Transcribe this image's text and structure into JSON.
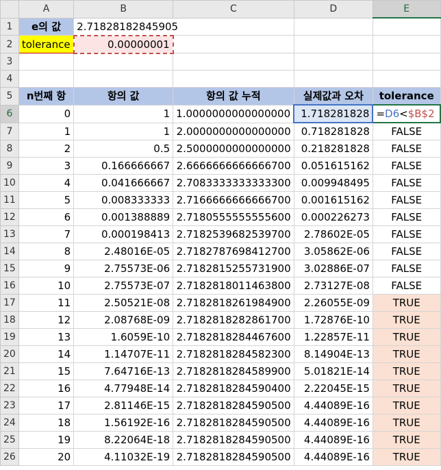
{
  "columns": [
    "A",
    "B",
    "C",
    "D",
    "E"
  ],
  "row_numbers": [
    "1",
    "2",
    "3",
    "4",
    "5",
    "6",
    "7",
    "8",
    "9",
    "10",
    "11",
    "12",
    "13",
    "14",
    "15",
    "16",
    "17",
    "18",
    "19",
    "20",
    "21",
    "22",
    "23",
    "24",
    "25",
    "26"
  ],
  "row1": {
    "label": "e의 값",
    "value": "2.71828182845905"
  },
  "row2": {
    "label": "tolerance",
    "value": "0.00000001"
  },
  "headers": {
    "a": "n번째 항",
    "b": "항의 값",
    "c": "항의 값 누적",
    "d": "실제값과 오차",
    "e": "tolerance"
  },
  "formula": {
    "eq": "=",
    "d": "D6",
    "lt": "<",
    "b": "$B$2"
  },
  "rows": [
    {
      "n": "0",
      "term": "1",
      "cum": "1.0000000000000000",
      "err": "1.718281828",
      "tol": ""
    },
    {
      "n": "1",
      "term": "1",
      "cum": "2.0000000000000000",
      "err": "0.718281828",
      "tol": "FALSE"
    },
    {
      "n": "2",
      "term": "0.5",
      "cum": "2.5000000000000000",
      "err": "0.218281828",
      "tol": "FALSE"
    },
    {
      "n": "3",
      "term": "0.166666667",
      "cum": "2.6666666666666700",
      "err": "0.051615162",
      "tol": "FALSE"
    },
    {
      "n": "4",
      "term": "0.041666667",
      "cum": "2.7083333333333300",
      "err": "0.009948495",
      "tol": "FALSE"
    },
    {
      "n": "5",
      "term": "0.008333333",
      "cum": "2.7166666666666700",
      "err": "0.001615162",
      "tol": "FALSE"
    },
    {
      "n": "6",
      "term": "0.001388889",
      "cum": "2.7180555555555600",
      "err": "0.000226273",
      "tol": "FALSE"
    },
    {
      "n": "7",
      "term": "0.000198413",
      "cum": "2.7182539682539700",
      "err": "2.78602E-05",
      "tol": "FALSE"
    },
    {
      "n": "8",
      "term": "2.48016E-05",
      "cum": "2.7182787698412700",
      "err": "3.05862E-06",
      "tol": "FALSE"
    },
    {
      "n": "9",
      "term": "2.75573E-06",
      "cum": "2.7182815255731900",
      "err": "3.02886E-07",
      "tol": "FALSE"
    },
    {
      "n": "10",
      "term": "2.75573E-07",
      "cum": "2.7182818011463800",
      "err": "2.73127E-08",
      "tol": "FALSE"
    },
    {
      "n": "11",
      "term": "2.50521E-08",
      "cum": "2.7182818261984900",
      "err": "2.26055E-09",
      "tol": "TRUE"
    },
    {
      "n": "12",
      "term": "2.08768E-09",
      "cum": "2.7182818282861700",
      "err": "1.72876E-10",
      "tol": "TRUE"
    },
    {
      "n": "13",
      "term": "1.6059E-10",
      "cum": "2.7182818284467600",
      "err": "1.22857E-11",
      "tol": "TRUE"
    },
    {
      "n": "14",
      "term": "1.14707E-11",
      "cum": "2.7182818284582300",
      "err": "8.14904E-13",
      "tol": "TRUE"
    },
    {
      "n": "15",
      "term": "7.64716E-13",
      "cum": "2.7182818284589900",
      "err": "5.01821E-14",
      "tol": "TRUE"
    },
    {
      "n": "16",
      "term": "4.77948E-14",
      "cum": "2.7182818284590400",
      "err": "2.22045E-15",
      "tol": "TRUE"
    },
    {
      "n": "17",
      "term": "2.81146E-15",
      "cum": "2.7182818284590500",
      "err": "4.44089E-16",
      "tol": "TRUE"
    },
    {
      "n": "18",
      "term": "1.56192E-16",
      "cum": "2.7182818284590500",
      "err": "4.44089E-16",
      "tol": "TRUE"
    },
    {
      "n": "19",
      "term": "8.22064E-18",
      "cum": "2.7182818284590500",
      "err": "4.44089E-16",
      "tol": "TRUE"
    },
    {
      "n": "20",
      "term": "4.11032E-19",
      "cum": "2.7182818284590500",
      "err": "4.44089E-16",
      "tol": "TRUE"
    }
  ],
  "colors": {
    "header_fill": "#b4c6e7",
    "true_fill": "#fbe1d3",
    "label_fill": "#ffff00",
    "selection": "#217346"
  }
}
